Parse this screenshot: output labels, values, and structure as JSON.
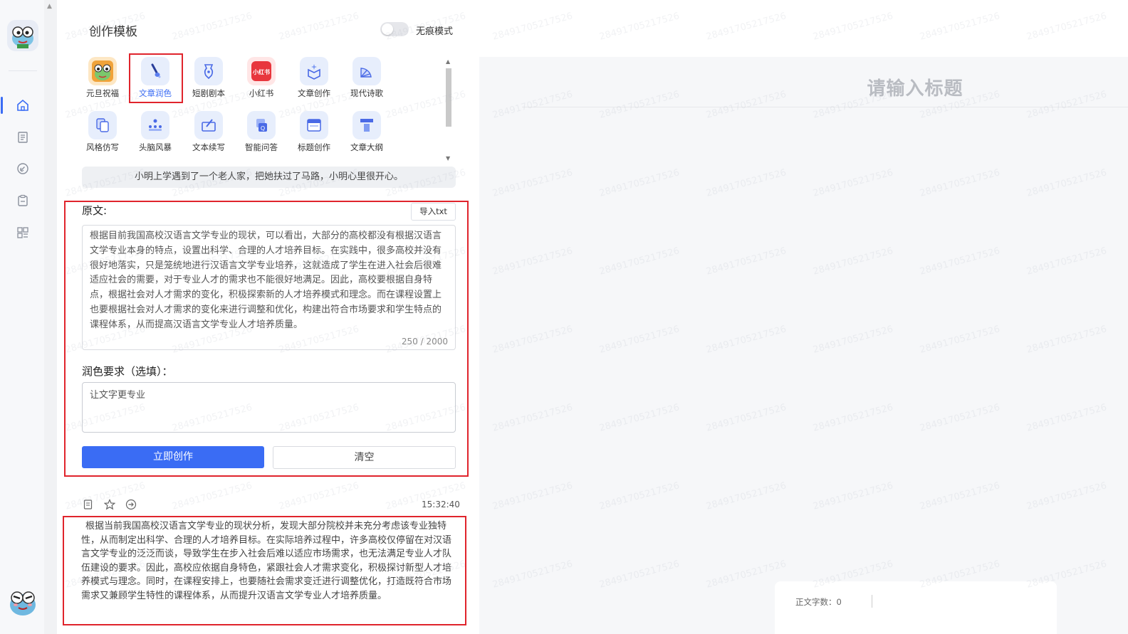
{
  "sidebar": {
    "nav": [
      {
        "name": "home",
        "active": true
      },
      {
        "name": "document",
        "active": false
      },
      {
        "name": "link",
        "active": false
      },
      {
        "name": "clipboard",
        "active": false
      },
      {
        "name": "apps",
        "active": false
      }
    ]
  },
  "panel": {
    "title": "创作模板",
    "incognito_label": "无痕模式",
    "incognito_on": false,
    "templates": [
      {
        "label": "元旦祝福",
        "icon": "frog-avatar-icon",
        "selected": false
      },
      {
        "label": "文章润色",
        "icon": "brush-icon",
        "selected": true
      },
      {
        "label": "短剧剧本",
        "icon": "pen-nib-icon",
        "selected": false
      },
      {
        "label": "小红书",
        "icon": "xiaohongshu-icon",
        "selected": false
      },
      {
        "label": "文章创作",
        "icon": "box-sparkle-icon",
        "selected": false
      },
      {
        "label": "现代诗歌",
        "icon": "fan-icon",
        "selected": false
      },
      {
        "label": "风格仿写",
        "icon": "copy-icon",
        "selected": false
      },
      {
        "label": "头脑风暴",
        "icon": "team-icon",
        "selected": false
      },
      {
        "label": "文本续写",
        "icon": "edit-box-icon",
        "selected": false
      },
      {
        "label": "智能问答",
        "icon": "qa-icon",
        "selected": false
      },
      {
        "label": "标题创作",
        "icon": "title-icon",
        "selected": false
      },
      {
        "label": "文章大纲",
        "icon": "outline-icon",
        "selected": false
      }
    ],
    "hint": "小明上学遇到了一个老人家，把她扶过了马路，小明心里很开心。",
    "original_label": "原文:",
    "import_label": "导入txt",
    "original_text": "根据目前我国高校汉语言文学专业的现状，可以看出，大部分的高校都没有根据汉语言文学专业本身的特点，设置出科学、合理的人才培养目标。在实践中，很多高校并没有很好地落实，只是笼统地进行汉语言文学专业培养，这就造成了学生在进入社会后很难适应社会的需要，对于专业人才的需求也不能很好地满足。因此，高校要根据自身特点，根据社会对人才需求的变化，积极探索新的人才培养模式和理念。而在课程设置上也要根据社会对人才需求的变化来进行调整和优化，构建出符合市场要求和学生特点的课程体系，从而提高汉语言文学专业人才培养质量。",
    "char_count": "250 / 2000",
    "polish_label": "润色要求（选填）：",
    "polish_value": "让文字更专业",
    "create_label": "立即创作",
    "clear_label": "清空",
    "result_time": "15:32:40",
    "result_text": "根据当前我国高校汉语言文学专业的现状分析，发现大部分院校并未充分考虑该专业独特性，从而制定出科学、合理的人才培养目标。在实际培养过程中，许多高校仅停留在对汉语言文学专业的泛泛而谈，导致学生在步入社会后难以适应市场需求，也无法满足专业人才队伍建设的要求。因此，高校应依据自身特色，紧跟社会人才需求变化，积极探讨新型人才培养模式与理念。同时，在课程安排上，也要随社会需求变迁进行调整优化，打造既符合市场需求又兼顾学生特性的课程体系，从而提升汉语言文学专业人才培养质量。"
  },
  "editor": {
    "title_placeholder": "请输入标题",
    "word_count": "正文字数：0"
  },
  "watermark": "28491705217526",
  "colors": {
    "accent": "#3a6cf4",
    "highlight": "#e0242c"
  }
}
